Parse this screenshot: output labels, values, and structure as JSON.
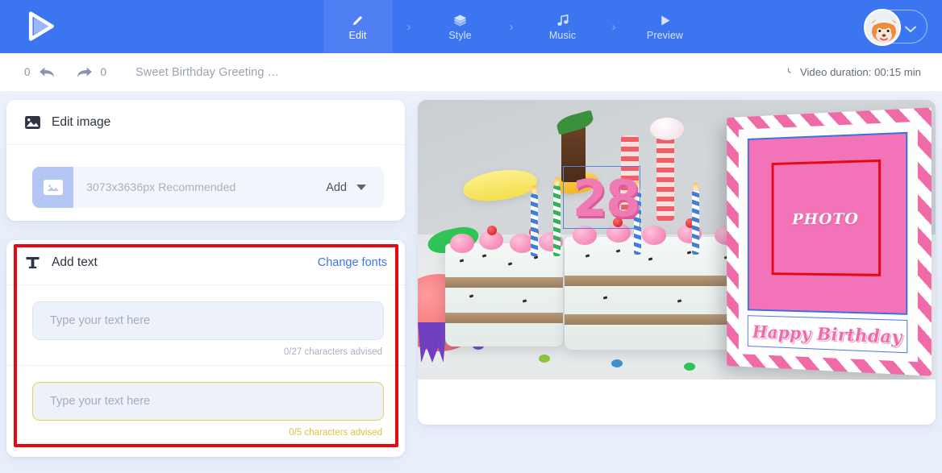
{
  "brand": {
    "logo_icon": "play-triangle-logo",
    "accent": "#3b76f0"
  },
  "topnav": {
    "steps": [
      {
        "label": "Edit",
        "icon": "pencil-icon",
        "active": true
      },
      {
        "label": "Style",
        "icon": "layers-icon",
        "active": false
      },
      {
        "label": "Music",
        "icon": "music-note-icon",
        "active": false
      },
      {
        "label": "Preview",
        "icon": "play-icon",
        "active": false
      }
    ],
    "separator": "›",
    "account": {
      "avatar_icon": "fox-avatar",
      "dropdown_icon": "chevron-down-icon"
    }
  },
  "subbar": {
    "undo_count": "0",
    "undo_icon": "undo-arrow-icon",
    "redo_icon": "redo-arrow-icon",
    "redo_count": "0",
    "project_title": "Sweet Birthday Greeting …",
    "duration_icon": "clock-icon",
    "duration_text": "Video duration: 00:15 min"
  },
  "edit_image": {
    "icon": "image-icon",
    "title": "Edit image",
    "thumb_icon": "image-placeholder-icon",
    "recommended": "3073x3636px Recommended",
    "add_label": "Add",
    "add_caret_icon": "caret-down-icon"
  },
  "add_text": {
    "icon": "text-t-icon",
    "title": "Add text",
    "change_fonts_label": "Change fonts",
    "fields": [
      {
        "placeholder": "Type your text here",
        "value": "",
        "counter": "0/27 characters advised",
        "state": "normal"
      },
      {
        "placeholder": "Type your text here",
        "value": "",
        "counter": "0/5 characters advised",
        "state": "warn"
      }
    ],
    "annotation_color": "#e50914"
  },
  "preview": {
    "scene_number": "28",
    "frame": {
      "photo_placeholder": "PHOTO",
      "caption": "Happy Birthday"
    },
    "selection_color": "#5b7fe0",
    "annotation_color": "#e50914"
  }
}
